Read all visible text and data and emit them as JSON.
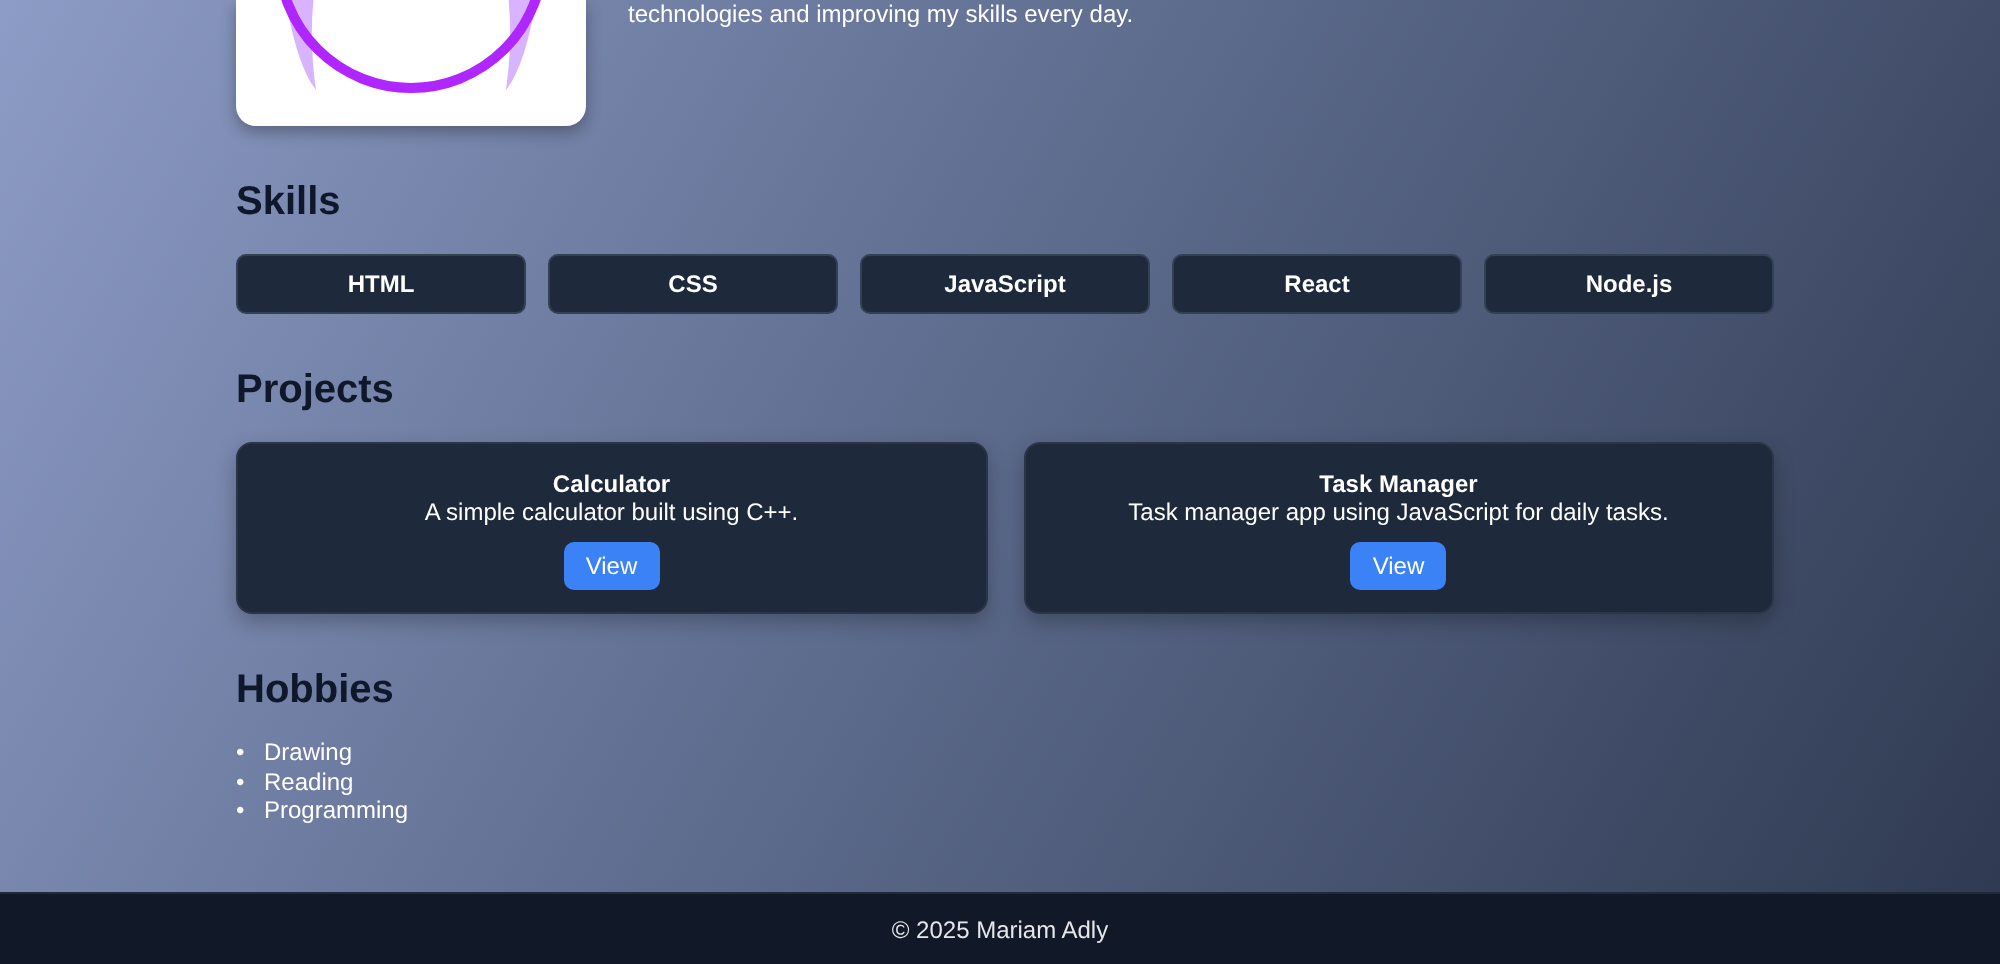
{
  "intro": {
    "text": "technologies and improving my skills every day."
  },
  "skills": {
    "title": "Skills",
    "items": [
      "HTML",
      "CSS",
      "JavaScript",
      "React",
      "Node.js"
    ]
  },
  "projects": {
    "title": "Projects",
    "items": [
      {
        "name": "Calculator",
        "description": "A simple calculator built using C++.",
        "button": "View"
      },
      {
        "name": "Task Manager",
        "description": "Task manager app using JavaScript for daily tasks.",
        "button": "View"
      }
    ]
  },
  "hobbies": {
    "title": "Hobbies",
    "marker": "•",
    "items": [
      "Drawing",
      "Reading",
      "Programming"
    ]
  },
  "footer": {
    "text": "© 2025 Mariam Adly"
  }
}
